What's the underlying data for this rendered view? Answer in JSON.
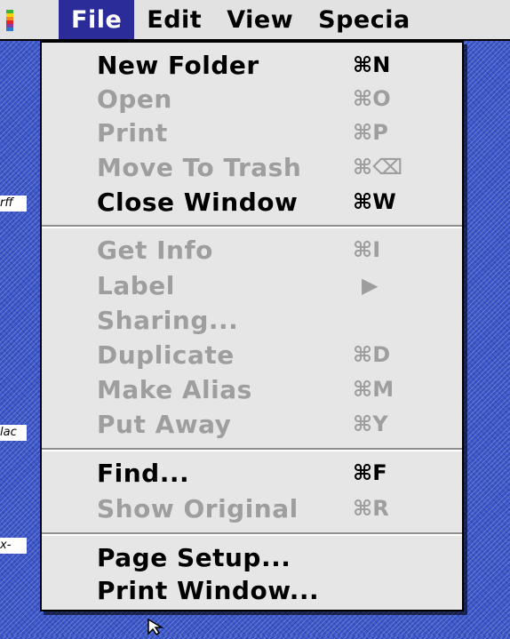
{
  "menubar": {
    "menus": [
      {
        "label": "File",
        "active": true
      },
      {
        "label": "Edit",
        "active": false
      },
      {
        "label": "View",
        "active": false
      },
      {
        "label": "Specia",
        "active": false
      }
    ],
    "apple_icon": "apple-menu-icon"
  },
  "file_menu": {
    "items": [
      {
        "label": "New Folder",
        "shortcut": "⌘N",
        "enabled": true
      },
      {
        "label": "Open",
        "shortcut": "⌘O",
        "enabled": false
      },
      {
        "label": "Print",
        "shortcut": "⌘P",
        "enabled": false
      },
      {
        "label": "Move To Trash",
        "shortcut": "⌘⌫",
        "enabled": false
      },
      {
        "label": "Close Window",
        "shortcut": "⌘W",
        "enabled": true
      },
      {
        "label": "Get Info",
        "shortcut": "⌘I",
        "enabled": false
      },
      {
        "label": "Label",
        "shortcut": "▶",
        "enabled": false
      },
      {
        "label": "Sharing...",
        "shortcut": "",
        "enabled": false
      },
      {
        "label": "Duplicate",
        "shortcut": "⌘D",
        "enabled": false
      },
      {
        "label": "Make Alias",
        "shortcut": "⌘M",
        "enabled": false
      },
      {
        "label": "Put Away",
        "shortcut": "⌘Y",
        "enabled": false
      },
      {
        "label": "Find...",
        "shortcut": "⌘F",
        "enabled": true
      },
      {
        "label": "Show Original",
        "shortcut": "⌘R",
        "enabled": false
      },
      {
        "label": "Page Setup...",
        "shortcut": "",
        "enabled": true
      },
      {
        "label": "Print Window...",
        "shortcut": "",
        "enabled": true
      }
    ]
  },
  "desktop": {
    "fragments": [
      "rff",
      "lac",
      "x-"
    ]
  },
  "colors": {
    "menu_highlight": "#2b2b9a",
    "menu_bg": "#e6e6e6",
    "disabled_text": "#9e9e9e",
    "desktop": "#3a56c8"
  }
}
